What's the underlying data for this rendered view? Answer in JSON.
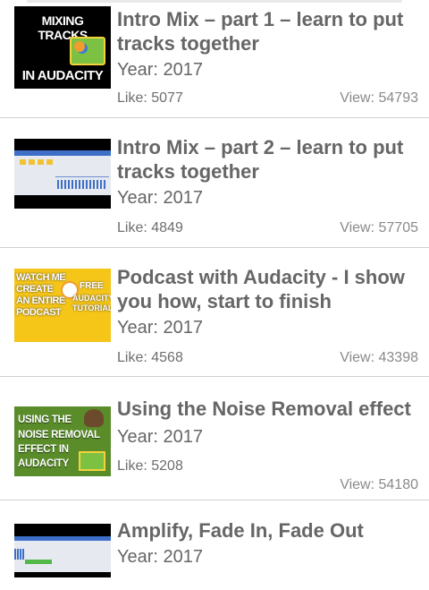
{
  "videos": [
    {
      "title": "Intro Mix – part 1 – learn to put tracks together",
      "year": "Year: 2017",
      "likes": "Like: 5077",
      "views": "View: 54793",
      "thumb_text": [
        "MIXING TRACKS",
        "IN AUDACITY"
      ]
    },
    {
      "title": "Intro Mix – part 2 – learn to put tracks together",
      "year": "Year: 2017",
      "likes": "Like: 4849",
      "views": "View: 57705"
    },
    {
      "title": "Podcast with Audacity - I show you how, start to finish",
      "year": "Year: 2017",
      "likes": "Like: 4568",
      "views": "View: 43398",
      "thumb_text": [
        "WATCH ME",
        "CREATE",
        "AN ENTIRE",
        "PODCAST",
        "FREE",
        "AUDACITY",
        "TUTORIALS"
      ]
    },
    {
      "title": "Using the Noise Removal effect",
      "year": "Year: 2017",
      "likes": "Like: 5208",
      "views": "View: 54180",
      "thumb_text": [
        "USING THE",
        "NOISE REMOVAL",
        "EFFECT IN",
        "AUDACITY"
      ]
    },
    {
      "title": "Amplify, Fade In, Fade Out",
      "year": "Year: 2017"
    }
  ]
}
